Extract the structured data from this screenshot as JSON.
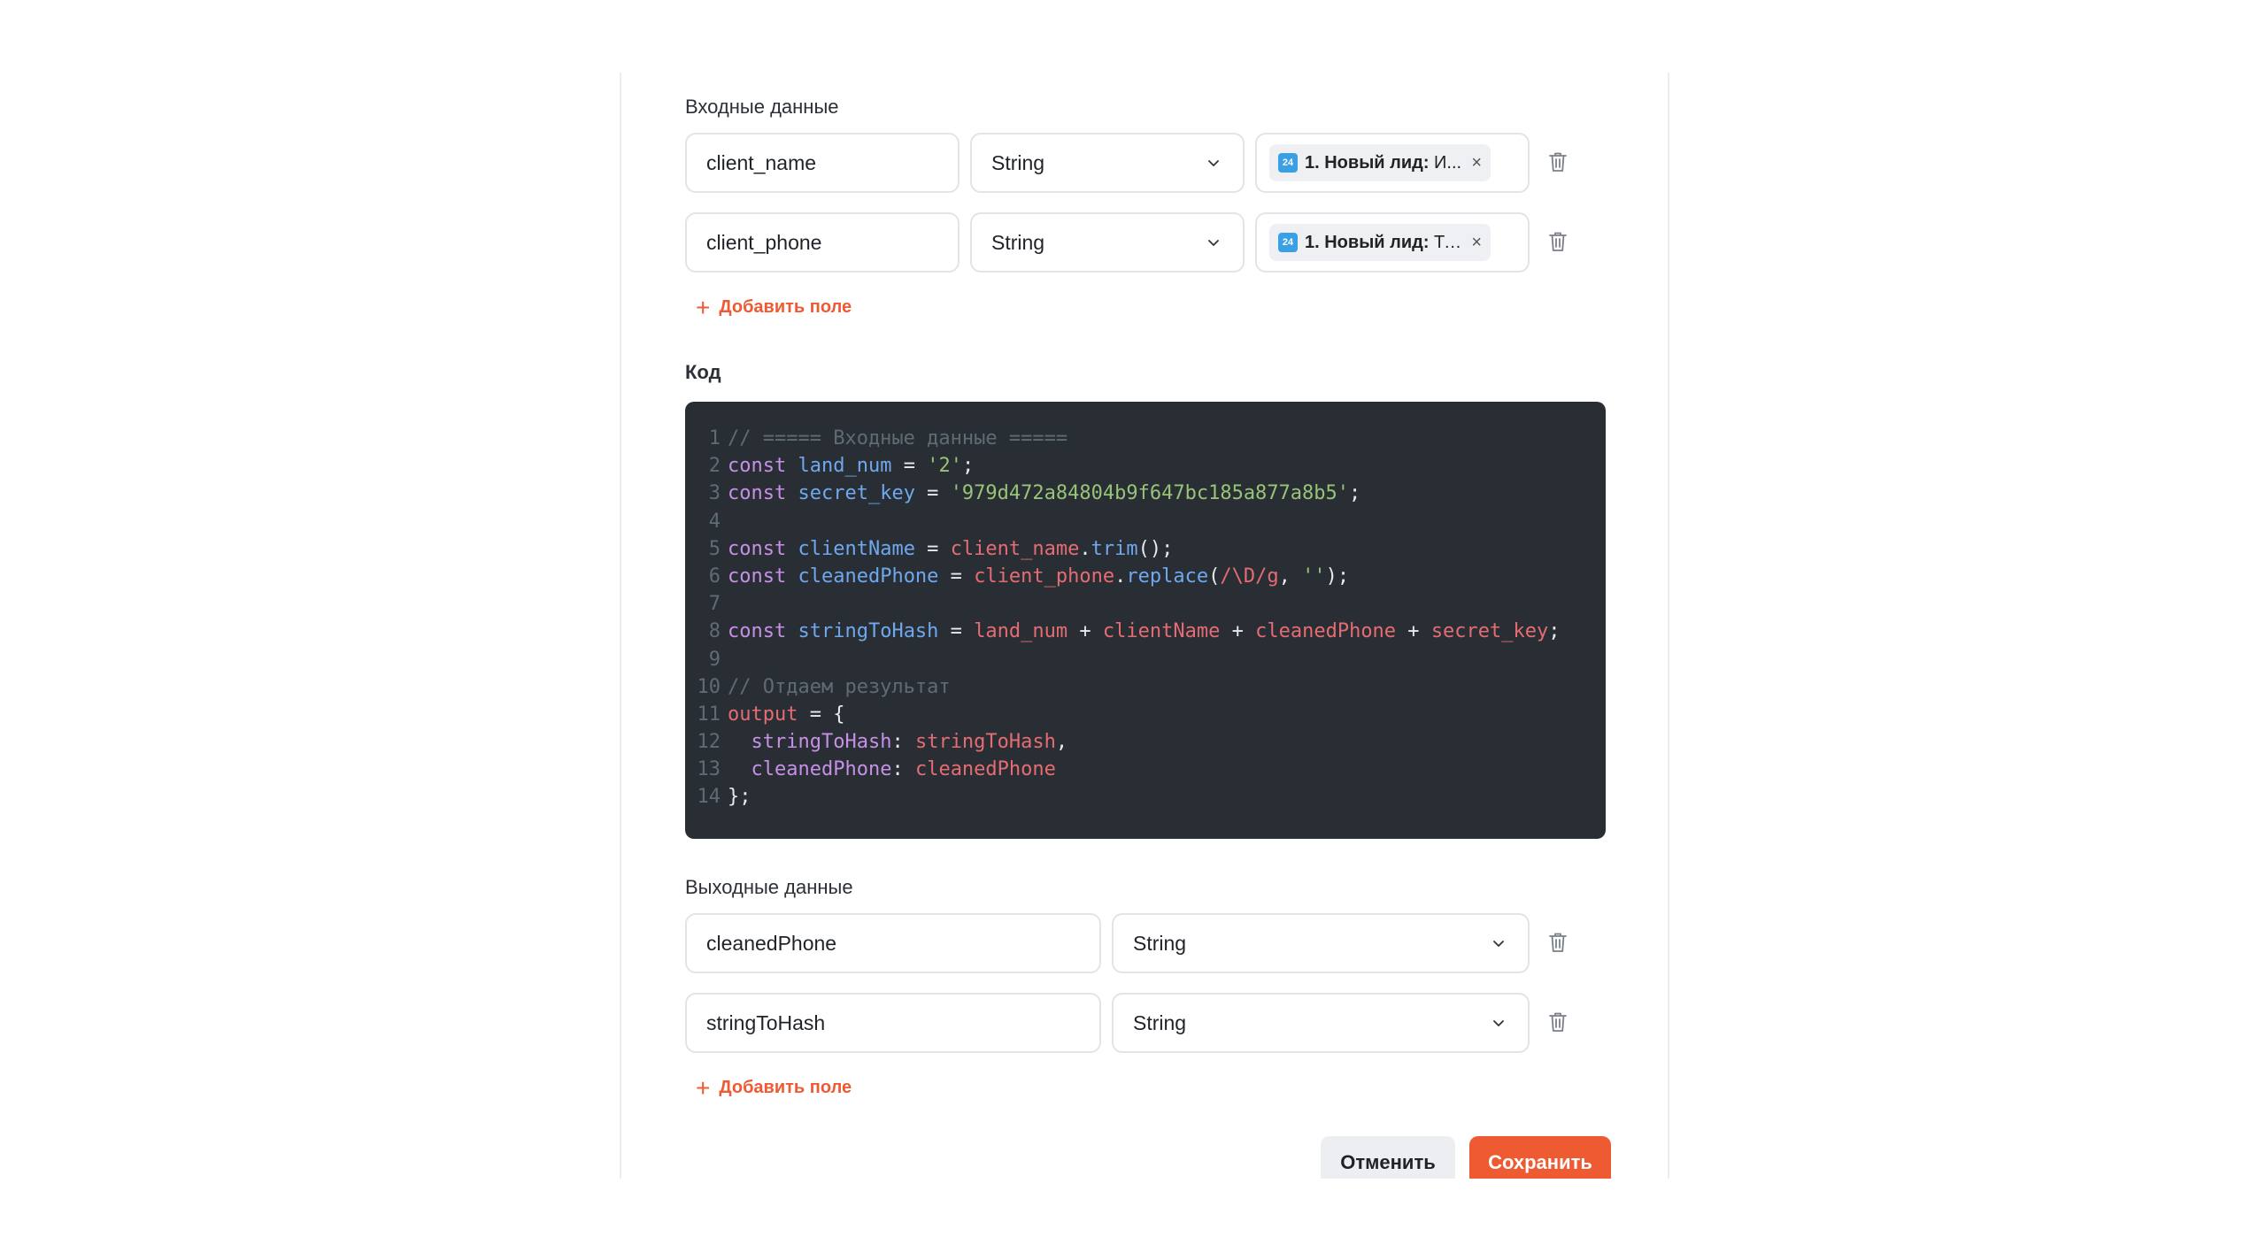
{
  "inputs": {
    "label": "Входные данные",
    "rows": [
      {
        "name": "client_name",
        "type": "String",
        "source_prefix": "1. Новый лид:",
        "source_value": " И..."
      },
      {
        "name": "client_phone",
        "type": "String",
        "source_prefix": "1. Новый лид:",
        "source_value": " Те..."
      }
    ],
    "add_label": "Добавить поле"
  },
  "code": {
    "label": "Код",
    "lines": [
      {
        "n": "1",
        "t": [
          [
            "comment",
            "// ===== Входные данные ====="
          ]
        ]
      },
      {
        "n": "2",
        "t": [
          [
            "kw",
            "const"
          ],
          [
            "punc",
            " "
          ],
          [
            "var",
            "land_num"
          ],
          [
            "punc",
            " = "
          ],
          [
            "str",
            "'2'"
          ],
          [
            "punc",
            ";"
          ]
        ]
      },
      {
        "n": "3",
        "t": [
          [
            "kw",
            "const"
          ],
          [
            "punc",
            " "
          ],
          [
            "var",
            "secret_key"
          ],
          [
            "punc",
            " = "
          ],
          [
            "str",
            "'979d472a84804b9f647bc185a877a8b5'"
          ],
          [
            "punc",
            ";"
          ]
        ]
      },
      {
        "n": "4",
        "t": []
      },
      {
        "n": "5",
        "t": [
          [
            "kw",
            "const"
          ],
          [
            "punc",
            " "
          ],
          [
            "var",
            "clientName"
          ],
          [
            "punc",
            " = "
          ],
          [
            "id",
            "client_name"
          ],
          [
            "punc",
            "."
          ],
          [
            "fn",
            "trim"
          ],
          [
            "punc",
            "();"
          ]
        ]
      },
      {
        "n": "6",
        "t": [
          [
            "kw",
            "const"
          ],
          [
            "punc",
            " "
          ],
          [
            "var",
            "cleanedPhone"
          ],
          [
            "punc",
            " = "
          ],
          [
            "id",
            "client_phone"
          ],
          [
            "punc",
            "."
          ],
          [
            "fn",
            "replace"
          ],
          [
            "punc",
            "("
          ],
          [
            "id",
            "/\\D/g"
          ],
          [
            "punc",
            ", "
          ],
          [
            "str",
            "''"
          ],
          [
            "punc",
            ");"
          ]
        ]
      },
      {
        "n": "7",
        "t": []
      },
      {
        "n": "8",
        "t": [
          [
            "kw",
            "const"
          ],
          [
            "punc",
            " "
          ],
          [
            "var",
            "stringToHash"
          ],
          [
            "punc",
            " = "
          ],
          [
            "id",
            "land_num"
          ],
          [
            "punc",
            " + "
          ],
          [
            "id",
            "clientName"
          ],
          [
            "punc",
            " + "
          ],
          [
            "id",
            "cleanedPhone"
          ],
          [
            "punc",
            " + "
          ],
          [
            "id",
            "secret_key"
          ],
          [
            "punc",
            ";"
          ]
        ]
      },
      {
        "n": "9",
        "t": []
      },
      {
        "n": "10",
        "t": [
          [
            "comment",
            "// Отдаем результат"
          ]
        ]
      },
      {
        "n": "11",
        "t": [
          [
            "id",
            "output"
          ],
          [
            "punc",
            " = {"
          ]
        ]
      },
      {
        "n": "12",
        "t": [
          [
            "punc",
            "  "
          ],
          [
            "prop",
            "stringToHash"
          ],
          [
            "punc",
            ": "
          ],
          [
            "id",
            "stringToHash"
          ],
          [
            "punc",
            ","
          ]
        ]
      },
      {
        "n": "13",
        "t": [
          [
            "punc",
            "  "
          ],
          [
            "prop",
            "cleanedPhone"
          ],
          [
            "punc",
            ": "
          ],
          [
            "id",
            "cleanedPhone"
          ]
        ]
      },
      {
        "n": "14",
        "t": [
          [
            "punc",
            "};"
          ]
        ]
      }
    ]
  },
  "outputs": {
    "label": "Выходные данные",
    "rows": [
      {
        "name": "cleanedPhone",
        "type": "String"
      },
      {
        "name": "stringToHash",
        "type": "String"
      }
    ],
    "add_label": "Добавить поле"
  },
  "buttons": {
    "cancel": "Отменить",
    "save": "Сохранить"
  },
  "icons": {
    "b24": "24",
    "remove": "×"
  },
  "colors": {
    "accent": "#ee5a32",
    "code_bg": "#282e33"
  }
}
